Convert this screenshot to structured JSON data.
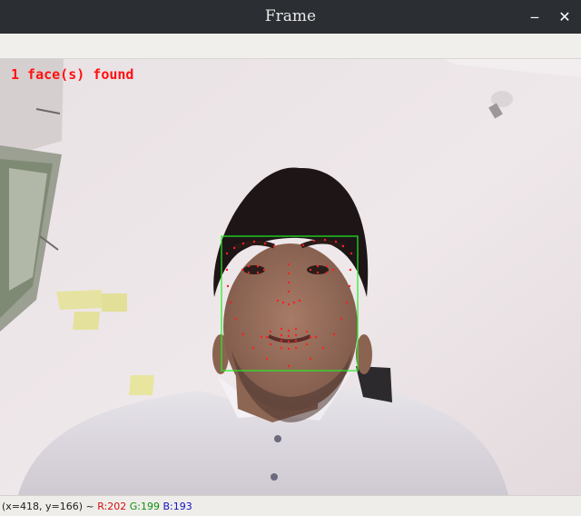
{
  "window": {
    "title": "Frame",
    "minimize_glyph": "‒",
    "close_glyph": "✕"
  },
  "overlay": {
    "detection_text": "1 face(s) found",
    "text_color": "#ff1010",
    "box_color": "#22ee22",
    "landmark_color": "#ff2020",
    "face_count": 1,
    "landmark_count": 68
  },
  "status": {
    "coords": "(x=418, y=166) ~",
    "r": "R:202",
    "g": "G:199",
    "b": "B:193"
  }
}
